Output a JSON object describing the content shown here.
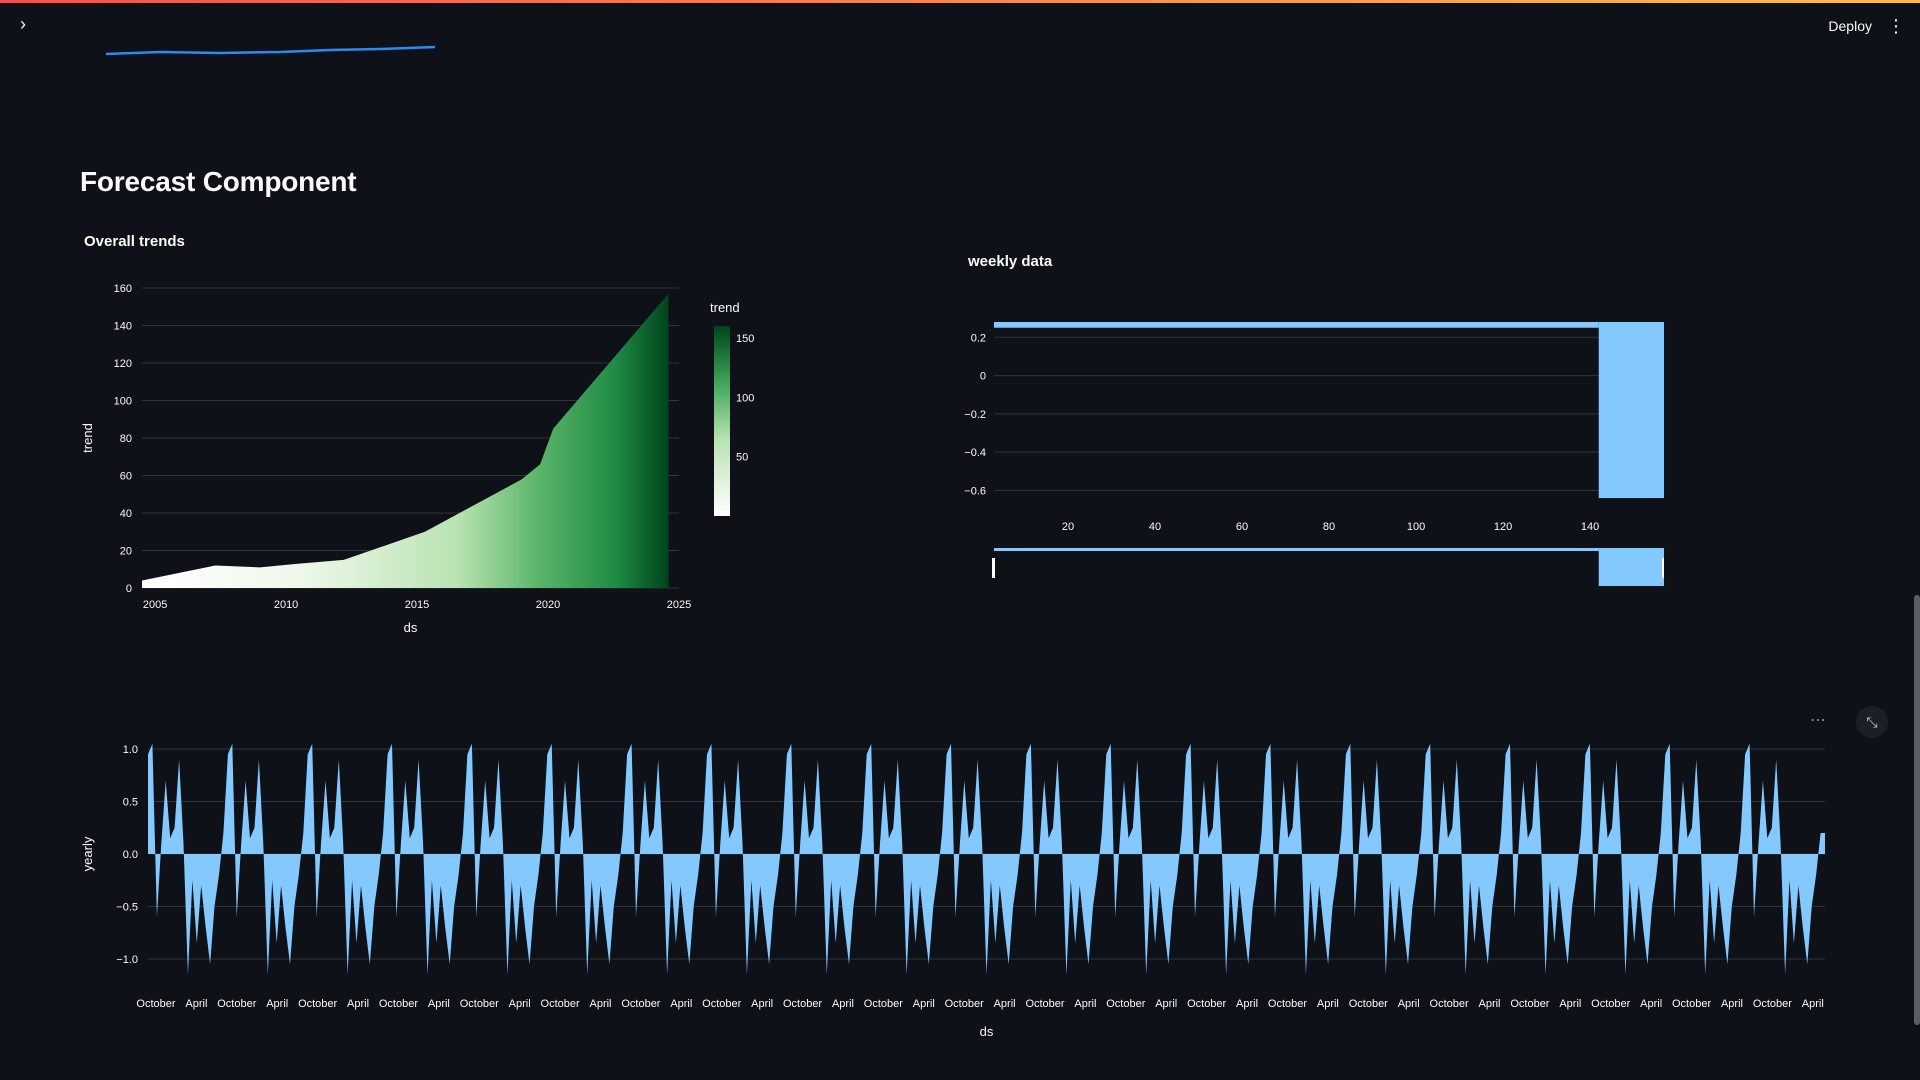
{
  "header": {
    "deploy_label": "Deploy",
    "menu_icon": "⋮",
    "sidebar_icon": "›"
  },
  "section": {
    "title": "Forecast Component"
  },
  "trend_chart": {
    "title": "Overall trends",
    "legend_title": "trend",
    "legend_ticks": [
      "150",
      "100",
      "50"
    ],
    "xlabel": "ds",
    "ylabel": "trend",
    "yticks": [
      "160",
      "140",
      "120",
      "100",
      "80",
      "60",
      "40",
      "20",
      "0"
    ],
    "xticks": [
      "2005",
      "2010",
      "2015",
      "2020",
      "2025"
    ]
  },
  "weekly_chart": {
    "title": "weekly data",
    "yticks": [
      "0.2",
      "0",
      "−0.2",
      "−0.4",
      "−0.6"
    ],
    "xticks": [
      "20",
      "40",
      "60",
      "80",
      "100",
      "120",
      "140"
    ]
  },
  "yearly_chart": {
    "xlabel": "ds",
    "ylabel": "yearly",
    "yticks": [
      "1.0",
      "0.5",
      "0.0",
      "−0.5",
      "−1.0"
    ],
    "xticks": [
      "October",
      "April",
      "October",
      "April",
      "October",
      "April",
      "October",
      "April",
      "October",
      "April",
      "October",
      "April",
      "October",
      "April",
      "October",
      "April",
      "October",
      "April",
      "October",
      "April",
      "October",
      "April",
      "October",
      "April",
      "October",
      "April",
      "October",
      "April",
      "October",
      "April",
      "October",
      "April",
      "October",
      "April",
      "October",
      "April",
      "October",
      "April",
      "October",
      "April",
      "October",
      "April"
    ]
  },
  "chart_data": [
    {
      "type": "area",
      "title": "Overall trends",
      "xlabel": "ds",
      "ylabel": "trend",
      "x": [
        2004.5,
        2007.3,
        2009,
        2010.5,
        2012.2,
        2015.3,
        2019,
        2019.7,
        2020.2,
        2024.6
      ],
      "y": [
        4,
        12,
        11,
        13,
        15,
        30,
        58,
        66,
        85,
        157
      ],
      "xlim": [
        2004.5,
        2025
      ],
      "ylim": [
        0,
        160
      ],
      "color_scale": "greens",
      "legend": "right",
      "grid": true
    },
    {
      "type": "area",
      "title": "weekly data",
      "x": [
        3,
        142,
        142,
        157
      ],
      "y": [
        0.25,
        0.25,
        -0.64,
        -0.64
      ],
      "xlim": [
        3,
        157
      ],
      "ylim": [
        -0.65,
        0.28
      ],
      "grid": true
    },
    {
      "type": "area",
      "xlabel": "ds",
      "ylabel": "yearly",
      "ylim": [
        -1.2,
        1.2
      ],
      "cycles": 21,
      "cycle_pattern": [
        0.95,
        1.05,
        -0.6,
        0.1,
        0.7,
        0.15,
        0.25,
        0.9,
        0.1,
        -1.15,
        -0.25,
        -0.85,
        -0.3,
        -0.7,
        -1.05,
        -0.5,
        -0.2,
        0.2
      ],
      "grid": true
    }
  ]
}
